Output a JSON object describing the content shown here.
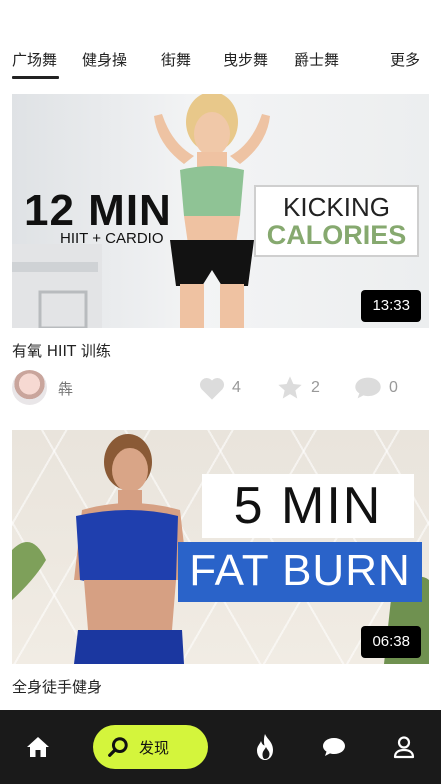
{
  "tabs": {
    "items": [
      {
        "label": "广场舞",
        "active": true
      },
      {
        "label": "健身操",
        "active": false
      },
      {
        "label": "街舞",
        "active": false
      },
      {
        "label": "曳步舞",
        "active": false
      },
      {
        "label": "爵士舞",
        "active": false
      }
    ],
    "more_label": "更多"
  },
  "videos": [
    {
      "thumbnail": {
        "headline_big": "12 MIN",
        "headline_small": "HIIT + CARDIO",
        "box_line1": "KICKING",
        "box_line2": "CALORIES"
      },
      "duration": "13:33",
      "title": "有氧 HIIT 训练",
      "author": "犇",
      "likes": "4",
      "stars": "2",
      "comments": "0"
    },
    {
      "thumbnail": {
        "line1": "5 MIN",
        "line2": "FAT BURN"
      },
      "duration": "06:38",
      "title": "全身徒手健身"
    }
  ],
  "bottom_nav": {
    "discover_label": "发现",
    "accent_color": "#d4f53c",
    "icons": [
      "home-icon",
      "search-icon",
      "fire-icon",
      "chat-icon",
      "profile-icon"
    ]
  }
}
